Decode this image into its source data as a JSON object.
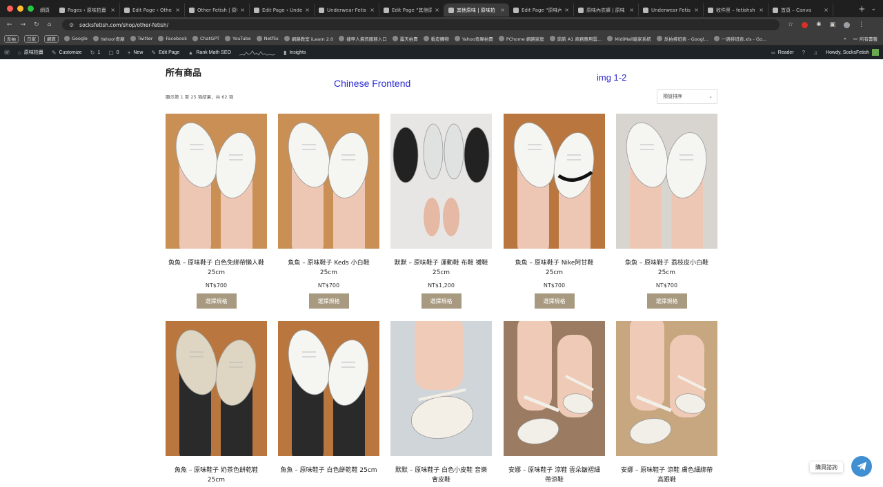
{
  "browser": {
    "tabs": [
      {
        "label": "網頁",
        "active": false,
        "small": true
      },
      {
        "label": "Pages ‹ 原味拍賣",
        "active": false
      },
      {
        "label": "Edit Page ‹ Othe",
        "active": false
      },
      {
        "label": "Other Fetish | 原味",
        "active": false
      },
      {
        "label": "Edit Page ‹ Unde",
        "active": false
      },
      {
        "label": "Underwear Fetis",
        "active": false
      },
      {
        "label": "Edit Page “其他原",
        "active": false
      },
      {
        "label": "其他原味 | 原味拍",
        "active": true
      },
      {
        "label": "Edit Page “原味內",
        "active": false
      },
      {
        "label": "原味內衣褲 | 原味",
        "active": false
      },
      {
        "label": "Underwear Fetis",
        "active": false
      },
      {
        "label": "收件匣 – fetishsh",
        "active": false
      },
      {
        "label": "首頁 – Canva",
        "active": false
      }
    ],
    "new_tab": "+",
    "url": "socksfetish.com/shop/other-fetish/",
    "bookmarks": [
      "反拍",
      "日家",
      "網頁",
      "Google",
      "Yahoo!奇摩",
      "Twitter",
      "Facebook",
      "ChatGPT",
      "YouTube",
      "Netflix",
      "網路教室 iLearn 2.0",
      "捷甲人資訊服務入口",
      "露天拍賣",
      "蝦皮購物",
      "Yahoo奇摩拍賣",
      "PChome 網路家庭",
      "鼎新 A1 商務應用雲...",
      "MidiMall廠家系統",
      "反拍排班表 - Googl...",
      "一週排班表.xls - Go..."
    ],
    "bookmarks_right": "所有書籤"
  },
  "admin_bar": {
    "site": "原味拍賣",
    "customize": "Customize",
    "updates": "1",
    "comments": "0",
    "new": "New",
    "edit": "Edit Page",
    "rankmath": "Rank Math SEO",
    "insights": "Insights",
    "reader": "Reader",
    "howdy": "Howdy, SocksFetish"
  },
  "page": {
    "title": "所有商品",
    "annotation_frontend": "Chinese Frontend",
    "annotation_img": "img 1-2",
    "result_count": "顯示第 1 至 25 項結果，共 62 項",
    "sort_label": "預設排序"
  },
  "products": [
    {
      "name": "魚魚 – 原味鞋子 白色免綁帶懶人鞋 25cm",
      "price": "NT$700",
      "button": "選擇規格",
      "scene": "canvas-white"
    },
    {
      "name": "魚魚 – 原味鞋子 Keds 小白鞋 25cm",
      "price": "NT$700",
      "button": "選擇規格",
      "scene": "keds"
    },
    {
      "name": "默默 – 原味鞋子 運動鞋 布鞋 襪鞋 25cm",
      "price": "NT$1,200",
      "button": "選擇規格",
      "scene": "insoles"
    },
    {
      "name": "魚魚 – 原味鞋子 Nike阿甘鞋 25cm",
      "price": "NT$700",
      "button": "選擇規格",
      "scene": "nike"
    },
    {
      "name": "魚魚 – 原味鞋子 荔枝皮小白鞋 25cm",
      "price": "NT$700",
      "button": "選擇規格",
      "scene": "leather-white"
    },
    {
      "name": "魚魚 – 原味鞋子 奶茶色餅乾鞋 25cm",
      "price": "",
      "button": "",
      "scene": "cracker-tan"
    },
    {
      "name": "魚魚 – 原味鞋子 白色餅乾鞋 25cm",
      "price": "",
      "button": "",
      "scene": "cracker-white"
    },
    {
      "name": "默默 – 原味鞋子 白色小皮鞋 音樂會皮鞋",
      "price": "",
      "button": "",
      "scene": "maryjane"
    },
    {
      "name": "安娜 – 原味鞋子 涼鞋 雲朵皺褶細帶涼鞋",
      "price": "",
      "button": "",
      "scene": "sandal-cloud"
    },
    {
      "name": "安娜 – 原味鞋子 涼鞋 膚色細綁帶高跟鞋",
      "price": "",
      "button": "",
      "scene": "sandal-strap"
    }
  ],
  "chat": {
    "label": "購買諮詢"
  }
}
